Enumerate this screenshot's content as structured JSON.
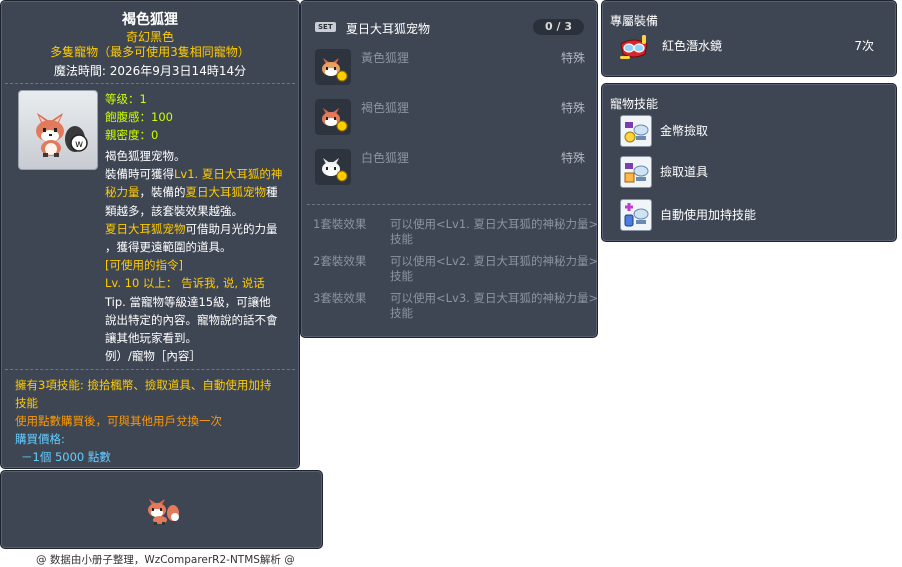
{
  "item_id": "05002252",
  "item": {
    "name": "褐色狐狸",
    "grade": "奇幻黑色",
    "category": "多隻寵物（最多可使用3隻相同寵物）",
    "magic_time": "魔法時間: 2026年9月3日14時14分",
    "stats": [
      "等级：1",
      "飽腹感：100",
      "親密度：0"
    ],
    "desc_lines": [
      {
        "text": "褐色狐狸宠物。",
        "color": "white"
      },
      {
        "parts": [
          {
            "t": "裝備時可獲得",
            "c": "white"
          },
          {
            "t": "Lv1. 夏日大耳狐的神",
            "c": "yellow"
          }
        ]
      },
      {
        "parts": [
          {
            "t": "秘力量",
            "c": "yellow"
          },
          {
            "t": "，裝備的",
            "c": "white"
          },
          {
            "t": "夏日大耳狐宠物",
            "c": "yellow"
          },
          {
            "t": "種",
            "c": "white"
          }
        ]
      },
      {
        "text": "類越多，該套裝效果越強。",
        "color": "white"
      },
      {
        "parts": [
          {
            "t": "夏日大耳狐宠物",
            "c": "yellow"
          },
          {
            "t": "可借助月光的力量",
            "c": "white"
          }
        ]
      },
      {
        "text": "，獲得更遠範圍的道具。",
        "color": "white"
      },
      {
        "text": "[可使用的指令]",
        "color": "yellow"
      },
      {
        "text": "Lv. 10 以上： 告诉我, 说, 说话",
        "color": "yellow"
      },
      {
        "text": "Tip. 當寵物等級達15級，可讓他",
        "color": "white"
      },
      {
        "text": "說出特定的內容。寵物說的話不會",
        "color": "white"
      },
      {
        "text": "讓其他玩家看到。",
        "color": "white"
      },
      {
        "text": "例）/寵物［內容］",
        "color": "white"
      }
    ],
    "skills_line1": "擁有3項技能: 撿拾楓幣、撿取道具、自動使用加持",
    "skills_line2": "技能",
    "trade_note": "使用點數購買後，可與其他用戶兌換一次",
    "price_label": "購買價格:",
    "price_value": "－1個 5000 點數"
  },
  "set": {
    "badge": "SET",
    "name": "夏日大耳狐宠物",
    "count": "0 / 3",
    "items": [
      {
        "name": "黃色狐狸",
        "type": "特殊"
      },
      {
        "name": "褐色狐狸",
        "type": "特殊"
      },
      {
        "name": "白色狐狸",
        "type": "特殊"
      }
    ],
    "effects": [
      {
        "key": "1套裝效果",
        "line1": "可以使用<Lv1. 夏日大耳狐的神秘力量>",
        "line2": "技能"
      },
      {
        "key": "2套裝效果",
        "line1": "可以使用<Lv2. 夏日大耳狐的神秘力量>",
        "line2": "技能"
      },
      {
        "key": "3套裝效果",
        "line1": "可以使用<Lv3. 夏日大耳狐的神秘力量>",
        "line2": "技能"
      }
    ]
  },
  "exclusive": {
    "title": "專屬裝備",
    "item_name": "紅色潛水鏡",
    "duration": "7次"
  },
  "pet_skills": {
    "title": "寵物技能",
    "items": [
      "金幣撿取",
      "撿取道具",
      "自動使用加持技能"
    ]
  },
  "footer": "@ 数据由小册子整理，WzComparerR2-NTMS解析 @",
  "colors": {
    "panel_bg": "#3f4653",
    "yellow": "#ffcc00",
    "green": "#ccff00",
    "orange": "#ff9900",
    "blue": "#66ccff"
  }
}
